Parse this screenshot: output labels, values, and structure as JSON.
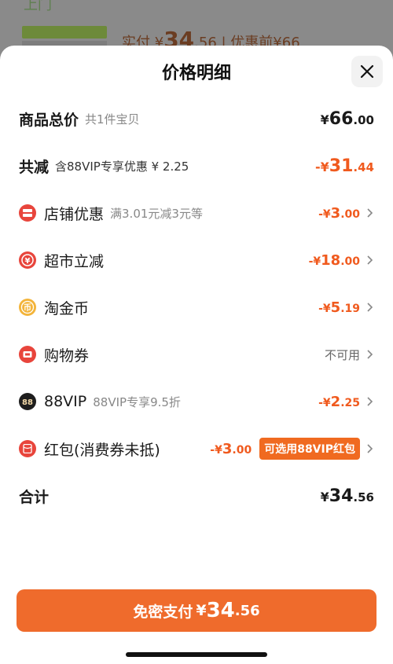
{
  "background": {
    "banner_text": "优惠前¥66",
    "price_prefix": "实付 ¥",
    "price_int": "34",
    "price_dec": ".56",
    "price_suffix": " | 优惠前¥66"
  },
  "sheet": {
    "title": "价格明细"
  },
  "rows": {
    "total": {
      "label": "商品总价",
      "sub": "共1件宝贝",
      "cur": "¥",
      "int": "66",
      "dec": ".00"
    },
    "reduce": {
      "label": "共减",
      "sub": "含88VIP专享优惠 ¥ 2.25",
      "cur": "-¥",
      "int": "31",
      "dec": ".44"
    },
    "shop": {
      "label": "店铺优惠",
      "sub": "满3.01元减3元等",
      "cur": "-¥",
      "int": "3",
      "dec": ".00",
      "icon": "shop-coupon-icon"
    },
    "market": {
      "label": "超市立减",
      "cur": "-¥",
      "int": "18",
      "dec": ".00",
      "icon": "yen-discount-icon"
    },
    "coin": {
      "label": "淘金币",
      "cur": "-¥",
      "int": "5",
      "dec": ".19",
      "icon": "gold-coin-icon"
    },
    "voucher": {
      "label": "购物券",
      "status": "不可用",
      "icon": "voucher-icon"
    },
    "vip": {
      "label": "88VIP",
      "sub": "88VIP专享9.5折",
      "cur": "-¥",
      "int": "2",
      "dec": ".25",
      "icon": "vip88-icon"
    },
    "redpack": {
      "label": "红包(消费券未抵)",
      "cur": "-¥",
      "int": "3",
      "dec": ".00",
      "button": "可选用88VIP红包",
      "icon": "red-packet-icon"
    },
    "sum": {
      "label": "合计",
      "cur": "¥",
      "int": "34",
      "dec": ".56"
    }
  },
  "pay_button": {
    "label": "免密支付",
    "cur": "¥",
    "int": "34",
    "dec": ".56"
  },
  "colors": {
    "accent": "#ef6b2c",
    "discount": "#f05a1e",
    "icon_red": "#e8453c",
    "icon_gold": "#f3b43a"
  }
}
